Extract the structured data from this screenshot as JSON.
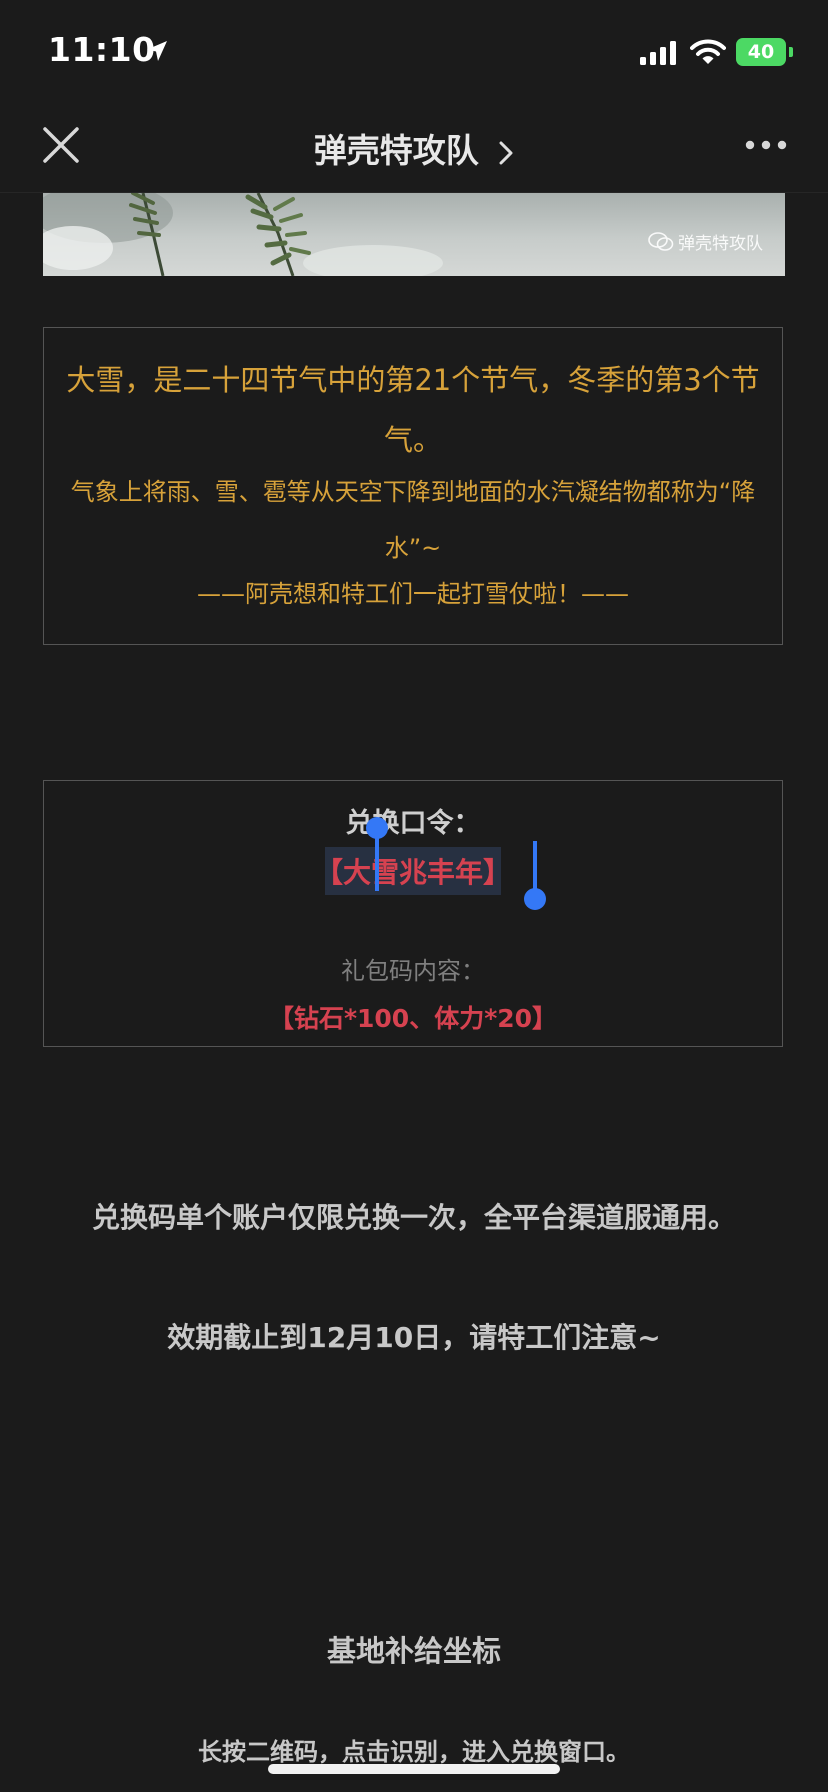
{
  "status_bar": {
    "time": "11:10",
    "battery": "40",
    "battery_color": "#4cd964"
  },
  "nav": {
    "title": "弹壳特攻队",
    "close_icon": "close-icon",
    "more_icon": "more-icon"
  },
  "header_image": {
    "watermark": "弹壳特攻队"
  },
  "intro": {
    "line1": "大雪，是二十四节气中的第21个节气，冬季的第3个节气。",
    "line2": "气象上将雨、雪、雹等从天空下降到地面的水汽凝结物都称为“降水”~",
    "line3": "——阿壳想和特工们一起打雪仗啦！——",
    "text_color": "#d7a23a"
  },
  "code": {
    "label": "兑换口令：",
    "value": "【大雪兆丰年】",
    "gift_label": "礼包码内容：",
    "gift_value": "【钻石*100、体力*20】",
    "accent_color": "#d64250",
    "selection_color": "#3478f6"
  },
  "notes": {
    "usage": "兑换码单个账户仅限兑换一次，全平台渠道服通用。",
    "expiry": "效期截止到12月10日，请特工们注意~",
    "section_title": "基地补给坐标",
    "instruction": "长按二维码，点击识别，进入兑换窗口。"
  }
}
